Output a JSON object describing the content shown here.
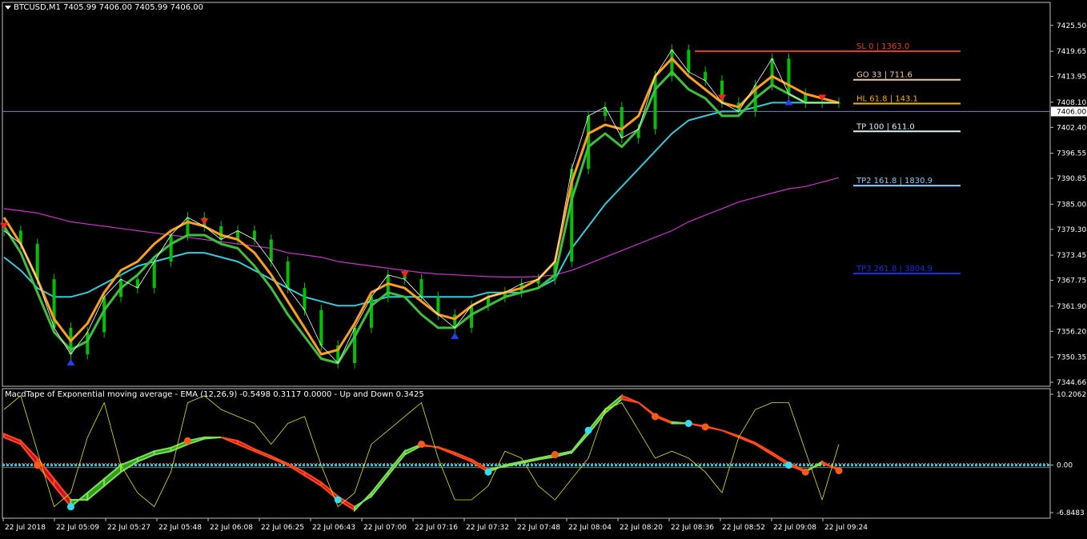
{
  "header": {
    "symbol_line": "BTCUSD,M1  7405.99 7406.00 7405.99 7406.00",
    "indicator_line": "MacdTape of Exponential moving average - EMA (12,26,9) -0.5498 0.3117 0.0000 - Up and Down 0.3425"
  },
  "colors": {
    "background": "#000000",
    "bull_candle": "#00c000",
    "macd_up_fill": "#2e9e1e",
    "macd_down_fill": "#c8102e",
    "fast_ma": "#ff9f1c",
    "slow_ma_green": "#3fbf3f",
    "cyan_ma": "#33ccdd",
    "magenta_ma": "#cc33cc",
    "signal_line": "#e6e600"
  },
  "chart_data": [
    {
      "type": "line",
      "title": "BTCUSD,M1",
      "ylim": [
        7344.66,
        7428.0
      ],
      "y_ticks": [
        "7425.50",
        "7419.65",
        "7413.95",
        "7408.10",
        "7402.40",
        "7396.55",
        "7390.85",
        "7385.00",
        "7379.30",
        "7373.45",
        "7367.75",
        "7361.90",
        "7356.20",
        "7350.35",
        "7344.66"
      ],
      "current_price": "7406.00",
      "x_ticks": [
        "22 Jul 2018",
        "22 Jul 05:09",
        "22 Jul 05:27",
        "22 Jul 05:48",
        "22 Jul 06:08",
        "22 Jul 06:25",
        "22 Jul 06:43",
        "22 Jul 07:00",
        "22 Jul 07:16",
        "22 Jul 07:32",
        "22 Jul 07:48",
        "22 Jul 08:04",
        "22 Jul 08:20",
        "22 Jul 08:36",
        "22 Jul 08:52",
        "22 Jul 09:08",
        "22 Jul 09:24"
      ],
      "x": [
        0,
        0.02,
        0.04,
        0.06,
        0.08,
        0.1,
        0.12,
        0.14,
        0.16,
        0.18,
        0.2,
        0.22,
        0.24,
        0.26,
        0.28,
        0.3,
        0.32,
        0.34,
        0.36,
        0.38,
        0.4,
        0.42,
        0.44,
        0.46,
        0.48,
        0.5,
        0.52,
        0.54,
        0.56,
        0.58,
        0.6,
        0.62,
        0.64,
        0.66,
        0.68,
        0.7,
        0.72,
        0.74,
        0.76,
        0.78,
        0.8,
        0.82,
        0.84,
        0.86,
        0.88,
        0.9,
        0.92,
        0.94,
        0.96,
        0.98,
        1.0
      ],
      "price": [
        7379,
        7376,
        7368,
        7357,
        7351,
        7356,
        7364,
        7368,
        7366,
        7372,
        7378,
        7382,
        7380,
        7377,
        7379,
        7377,
        7372,
        7366,
        7361,
        7353,
        7349,
        7357,
        7364,
        7369,
        7368,
        7364,
        7360,
        7357,
        7362,
        7364,
        7365,
        7367,
        7368,
        7372,
        7393,
        7405,
        7407,
        7400,
        7402,
        7414,
        7420,
        7415,
        7413,
        7408,
        7406,
        7412,
        7418,
        7410,
        7408,
        7408,
        7408
      ],
      "series": [
        {
          "name": "",
          "values": [
            7382,
            7376,
            7368,
            7359,
            7354,
            7358,
            7365,
            7370,
            7372,
            7376,
            7379,
            7381,
            7380,
            7378,
            7377,
            7374,
            7369,
            7363,
            7357,
            7351,
            7352,
            7358,
            7365,
            7367,
            7366,
            7363,
            7360,
            7359,
            7362,
            7364,
            7365,
            7366,
            7368,
            7372,
            7390,
            7401,
            7403,
            7402,
            7405,
            7414,
            7418,
            7414,
            7411,
            7408,
            7407,
            7411,
            7414,
            7412,
            7410,
            7409,
            7408
          ]
        },
        {
          "name": "",
          "values": [
            7380,
            7374,
            7365,
            7356,
            7352,
            7354,
            7361,
            7366,
            7369,
            7373,
            7376,
            7378,
            7378,
            7376,
            7375,
            7371,
            7366,
            7360,
            7355,
            7350,
            7349,
            7355,
            7362,
            7365,
            7364,
            7360,
            7357,
            7357,
            7360,
            7362,
            7364,
            7365,
            7366,
            7369,
            7386,
            7398,
            7401,
            7398,
            7402,
            7411,
            7415,
            7411,
            7409,
            7405,
            7405,
            7409,
            7412,
            7410,
            7408,
            7408,
            7408
          ]
        },
        {
          "name": "",
          "values": [
            7373,
            7370,
            7366,
            7364,
            7364,
            7365,
            7367,
            7369,
            7371,
            7372,
            7373,
            7374,
            7374,
            7373,
            7372,
            7370,
            7368,
            7366,
            7364,
            7363,
            7362,
            7362,
            7363,
            7364,
            7364,
            7364,
            7364,
            7364,
            7364,
            7365,
            7365,
            7365,
            7366,
            7368,
            7375,
            7380,
            7385,
            7389,
            7393,
            7397,
            7401,
            7404,
            7405,
            7406,
            7406,
            7407,
            7408,
            7408,
            7408,
            7408,
            7408
          ]
        },
        {
          "name": "",
          "values": [
            7384,
            7383.5,
            7383,
            7382,
            7381,
            7380.5,
            7380,
            7379.5,
            7379,
            7378.5,
            7378,
            7377.5,
            7377,
            7376.5,
            7376,
            7375.5,
            7375,
            7374,
            7373.5,
            7373,
            7372,
            7371.5,
            7371,
            7370.5,
            7370,
            7369.5,
            7369.2,
            7369,
            7368.8,
            7368.6,
            7368.5,
            7368.5,
            7368.6,
            7369,
            7370,
            7371.5,
            7373,
            7374.5,
            7376,
            7377.5,
            7379,
            7381,
            7382.5,
            7384,
            7385.5,
            7386.5,
            7387.5,
            7388.5,
            7389,
            7390,
            7391
          ]
        }
      ],
      "levels": [
        {
          "label": "SL   0        | 1363.0",
          "price": 7419.65,
          "color": "#e0401c"
        },
        {
          "label": "GO   33       | 711.6",
          "price": 7413.2,
          "color": "#f2c8b0"
        },
        {
          "label": "HL   61.8   | 143.1",
          "price": 7407.8,
          "color": "#f2b200"
        },
        {
          "label": "TP   100    | 611.0",
          "price": 7401.5,
          "color": "#d9f2f2"
        },
        {
          "label": "TP2  161.8  | 1830.9",
          "price": 7389.2,
          "color": "#87cefa"
        },
        {
          "label": "TP3  261.8  | 3804.9",
          "price": 7369.3,
          "color": "#1a2be0"
        }
      ]
    },
    {
      "type": "area",
      "title": "MacdTape of Exponential moving average - EMA (12,26,9)",
      "ylim": [
        -6.8483,
        10.2062
      ],
      "y_ticks": [
        "10.2062",
        "0.00",
        "-6.8483"
      ],
      "x": [
        0,
        0.02,
        0.04,
        0.06,
        0.08,
        0.1,
        0.12,
        0.14,
        0.16,
        0.18,
        0.2,
        0.22,
        0.24,
        0.26,
        0.28,
        0.3,
        0.32,
        0.34,
        0.36,
        0.38,
        0.4,
        0.42,
        0.44,
        0.46,
        0.48,
        0.5,
        0.52,
        0.54,
        0.56,
        0.58,
        0.6,
        0.62,
        0.64,
        0.66,
        0.68,
        0.7,
        0.72,
        0.74,
        0.76,
        0.78,
        0.8,
        0.82,
        0.84,
        0.86,
        0.88,
        0.9,
        0.92,
        0.94,
        0.96,
        0.98,
        1.0
      ],
      "macd": [
        4,
        3,
        0,
        -3,
        -6,
        -4,
        -2,
        0,
        1,
        2,
        2.5,
        3.5,
        4,
        4,
        3,
        2,
        1,
        0,
        -1.5,
        -3,
        -5,
        -6.5,
        -4,
        -1,
        2,
        3,
        2.5,
        1.5,
        0.5,
        -1,
        0,
        0.5,
        1,
        1.5,
        2,
        5,
        8,
        10,
        9,
        7,
        6,
        6,
        5.5,
        5,
        4,
        3,
        1.5,
        0,
        -1,
        0.5,
        -0.8
      ],
      "signal": [
        4.5,
        3.5,
        1,
        -2,
        -5,
        -5,
        -3,
        -1,
        0.5,
        1.5,
        2,
        3,
        3.8,
        4,
        3.5,
        2.3,
        1.3,
        0.2,
        -1,
        -2.5,
        -4.5,
        -6,
        -4.5,
        -1.5,
        1.5,
        2.8,
        2.6,
        1.8,
        0.8,
        -0.6,
        -0.2,
        0.3,
        0.8,
        1.2,
        1.8,
        4.5,
        7.5,
        9.5,
        9,
        7.2,
        6.2,
        6,
        5.6,
        5,
        4.2,
        3.2,
        1.8,
        0.3,
        -0.8,
        0.2,
        -0.5
      ],
      "yellow": [
        8,
        10,
        2,
        -6,
        -4,
        4,
        9,
        0,
        -4,
        -6,
        -1,
        9,
        10,
        8,
        7,
        6,
        3,
        6,
        7,
        0,
        -6,
        -4,
        3,
        5,
        7,
        9,
        1,
        -5,
        -5,
        -3,
        2,
        1,
        -3,
        -5,
        -2,
        1,
        8,
        9,
        5,
        1,
        2,
        1,
        -1,
        -4,
        4,
        8,
        9,
        9,
        2,
        -5,
        3
      ]
    }
  ]
}
